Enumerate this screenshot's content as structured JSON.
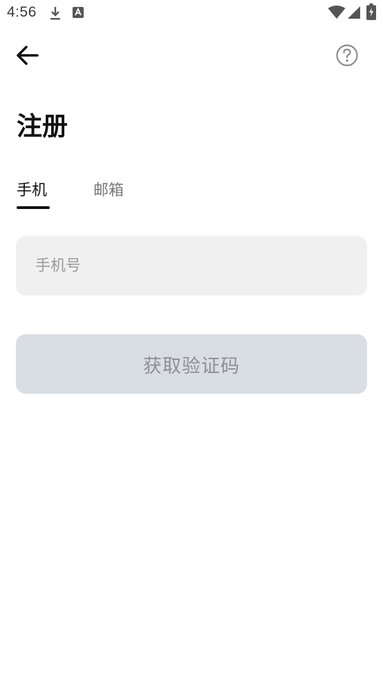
{
  "status_bar": {
    "time": "4:56",
    "left_icons": [
      "download-icon",
      "text-a-icon"
    ],
    "right_icons": [
      "wifi-icon",
      "signal-icon",
      "battery-charging-icon"
    ]
  },
  "header": {
    "back_icon": "arrow-left-icon",
    "help_icon": "question-circle-icon"
  },
  "page": {
    "title": "注册"
  },
  "tabs": [
    {
      "label": "手机",
      "active": true
    },
    {
      "label": "邮箱",
      "active": false
    }
  ],
  "form": {
    "phone_placeholder": "手机号",
    "phone_value": "",
    "submit_label": "获取验证码"
  },
  "colors": {
    "text_primary": "#111111",
    "text_secondary": "#777777",
    "input_bg": "#f0f0f0",
    "button_disabled_bg": "#d9dde4",
    "button_disabled_text": "#8e8f93"
  }
}
